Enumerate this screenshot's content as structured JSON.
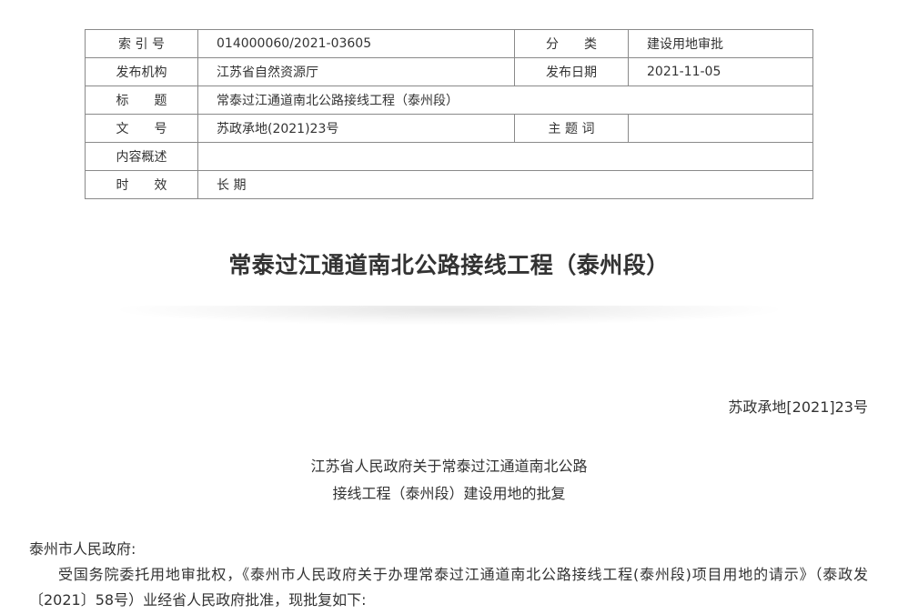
{
  "meta": {
    "index_no_label": "索 引 号",
    "index_no": "014000060/2021-03605",
    "category_label": "分　　类",
    "category": "建设用地审批",
    "publisher_label": "发布机构",
    "publisher": "江苏省自然资源厅",
    "publish_date_label": "发布日期",
    "publish_date": "2021-11-05",
    "title_label": "标　　题",
    "title": "常泰过江通道南北公路接线工程（泰州段）",
    "doc_no_label": "文　　号",
    "doc_no": "苏政承地(2021)23号",
    "keywords_label": "主 题 词",
    "keywords": "",
    "summary_label": "内容概述",
    "summary": "",
    "validity_label": "时　　效",
    "validity": "长 期"
  },
  "document": {
    "title": "常泰过江通道南北公路接线工程（泰州段）",
    "number": "苏政承地[2021]23号",
    "reply_heading_line1": "江苏省人民政府关于常泰过江通道南北公路",
    "reply_heading_line2": "接线工程（泰州段）建设用地的批复",
    "addressee": "泰州市人民政府:",
    "paragraph1": "受国务院委托用地审批权，《泰州市人民政府关于办理常泰过江通道南北公路接线工程(泰州段)项目用地的请示》（泰政发〔2021〕58号）业经省人民政府批准，现批复如下:"
  }
}
